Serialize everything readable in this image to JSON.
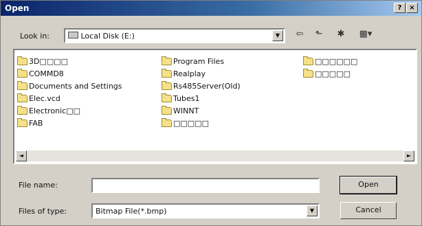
{
  "window": {
    "title": "Open",
    "help_label": "?",
    "close_label": "×"
  },
  "lookin": {
    "label": "Look in:",
    "value": "Local Disk (E:)",
    "icon": "drive-icon"
  },
  "toolbar": [
    {
      "name": "back-icon",
      "glyph": "⇦"
    },
    {
      "name": "up-folder-icon",
      "glyph": "⬑"
    },
    {
      "name": "new-folder-icon",
      "glyph": "✱"
    },
    {
      "name": "view-menu-icon",
      "glyph": "▦▾"
    }
  ],
  "files": {
    "col1": [
      {
        "label": "3D□□□□",
        "icon": "folder-icon"
      },
      {
        "label": "COMMD8",
        "icon": "folder-icon"
      },
      {
        "label": "Documents and Settings",
        "icon": "folder-icon"
      },
      {
        "label": "Elec.vcd",
        "icon": "folder-icon"
      },
      {
        "label": "Electronic□□",
        "icon": "folder-icon"
      },
      {
        "label": "FAB",
        "icon": "folder-icon"
      }
    ],
    "col2": [
      {
        "label": "Program Files",
        "icon": "folder-icon"
      },
      {
        "label": "Realplay",
        "icon": "folder-icon"
      },
      {
        "label": "Rs485Server(Old)",
        "icon": "folder-icon"
      },
      {
        "label": "Tubes1",
        "icon": "folder-icon"
      },
      {
        "label": "WINNT",
        "icon": "folder-icon"
      },
      {
        "label": "□□□□□",
        "icon": "folder-icon"
      }
    ],
    "col3": [
      {
        "label": "□□□□□□",
        "icon": "folder-icon"
      },
      {
        "label": "□□□□□",
        "icon": "folder-icon"
      }
    ]
  },
  "filename": {
    "label": "File name:",
    "value": ""
  },
  "filetype": {
    "label": "Files of type:",
    "value": "Bitmap File(*.bmp)"
  },
  "buttons": {
    "open": "Open",
    "cancel": "Cancel"
  },
  "arrows": {
    "down": "▼",
    "left": "◄",
    "right": "►"
  }
}
